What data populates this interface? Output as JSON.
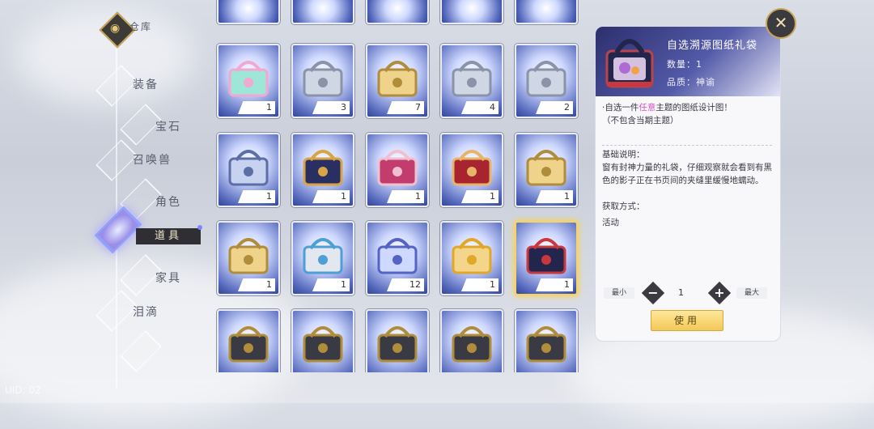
{
  "nav": {
    "logo_label": "仓库",
    "items": [
      {
        "label": "装备"
      },
      {
        "label": "宝石"
      },
      {
        "label": "召唤兽"
      },
      {
        "label": "角色"
      },
      {
        "label": "道具"
      },
      {
        "label": "家具"
      },
      {
        "label": "泪滴"
      }
    ],
    "active": "道具"
  },
  "grid": {
    "rows": [
      {
        "items": [
          {
            "name": "rainbow-chest",
            "count": "1"
          },
          {
            "name": "silver-gift-bag",
            "count": "3"
          },
          {
            "name": "gold-gift-bag",
            "count": "7"
          },
          {
            "name": "silver-gift-bag",
            "count": "4"
          },
          {
            "name": "silver-gift-bag",
            "count": "2"
          }
        ]
      },
      {
        "items": [
          {
            "name": "tech-case",
            "count": "1"
          },
          {
            "name": "navy-gold-chest",
            "count": "1"
          },
          {
            "name": "pink-ornate-chest",
            "count": "1"
          },
          {
            "name": "red-gift-box",
            "count": "1"
          },
          {
            "name": "gold-gift-bag",
            "count": "1"
          }
        ]
      },
      {
        "items": [
          {
            "name": "gold-gift-bag",
            "count": "1"
          },
          {
            "name": "silver-metal-case",
            "count": "1"
          },
          {
            "name": "blue-crystal-chest",
            "count": "12"
          },
          {
            "name": "phoenix-card",
            "count": "1"
          },
          {
            "name": "navy-gift-bag",
            "count": "1",
            "selected": true
          }
        ]
      },
      {
        "items": [
          {
            "name": "dark-spiked-chest",
            "count": ""
          },
          {
            "name": "dark-spiked-chest",
            "count": ""
          },
          {
            "name": "dark-spiked-chest",
            "count": ""
          },
          {
            "name": "dark-spiked-chest",
            "count": ""
          },
          {
            "name": "dark-spiked-chest",
            "count": ""
          }
        ]
      }
    ]
  },
  "detail": {
    "title": "自选溯源图纸礼袋",
    "quantity": "数量：1",
    "quality": "品质：神谕",
    "desc_prefix": "·自选一件",
    "desc_highlight": "任意",
    "desc_suffix": "主题的图纸设计图！",
    "desc_line2": "（不包含当期主题）",
    "basic_heading": "基础说明：",
    "basic_text": "窗有封神力量的礼袋，仔细观察就会看到有黑色的影子正在书页间的夹缝里缓慢地蠕动。",
    "source_heading": "获取方式：",
    "source_text": "活动",
    "min_label": "最小",
    "max_label": "最大",
    "minus_symbol": "−",
    "plus_symbol": "+",
    "amount": "1",
    "use_label": "使用"
  },
  "close_symbol": "✕",
  "watermark": "UID: 02"
}
